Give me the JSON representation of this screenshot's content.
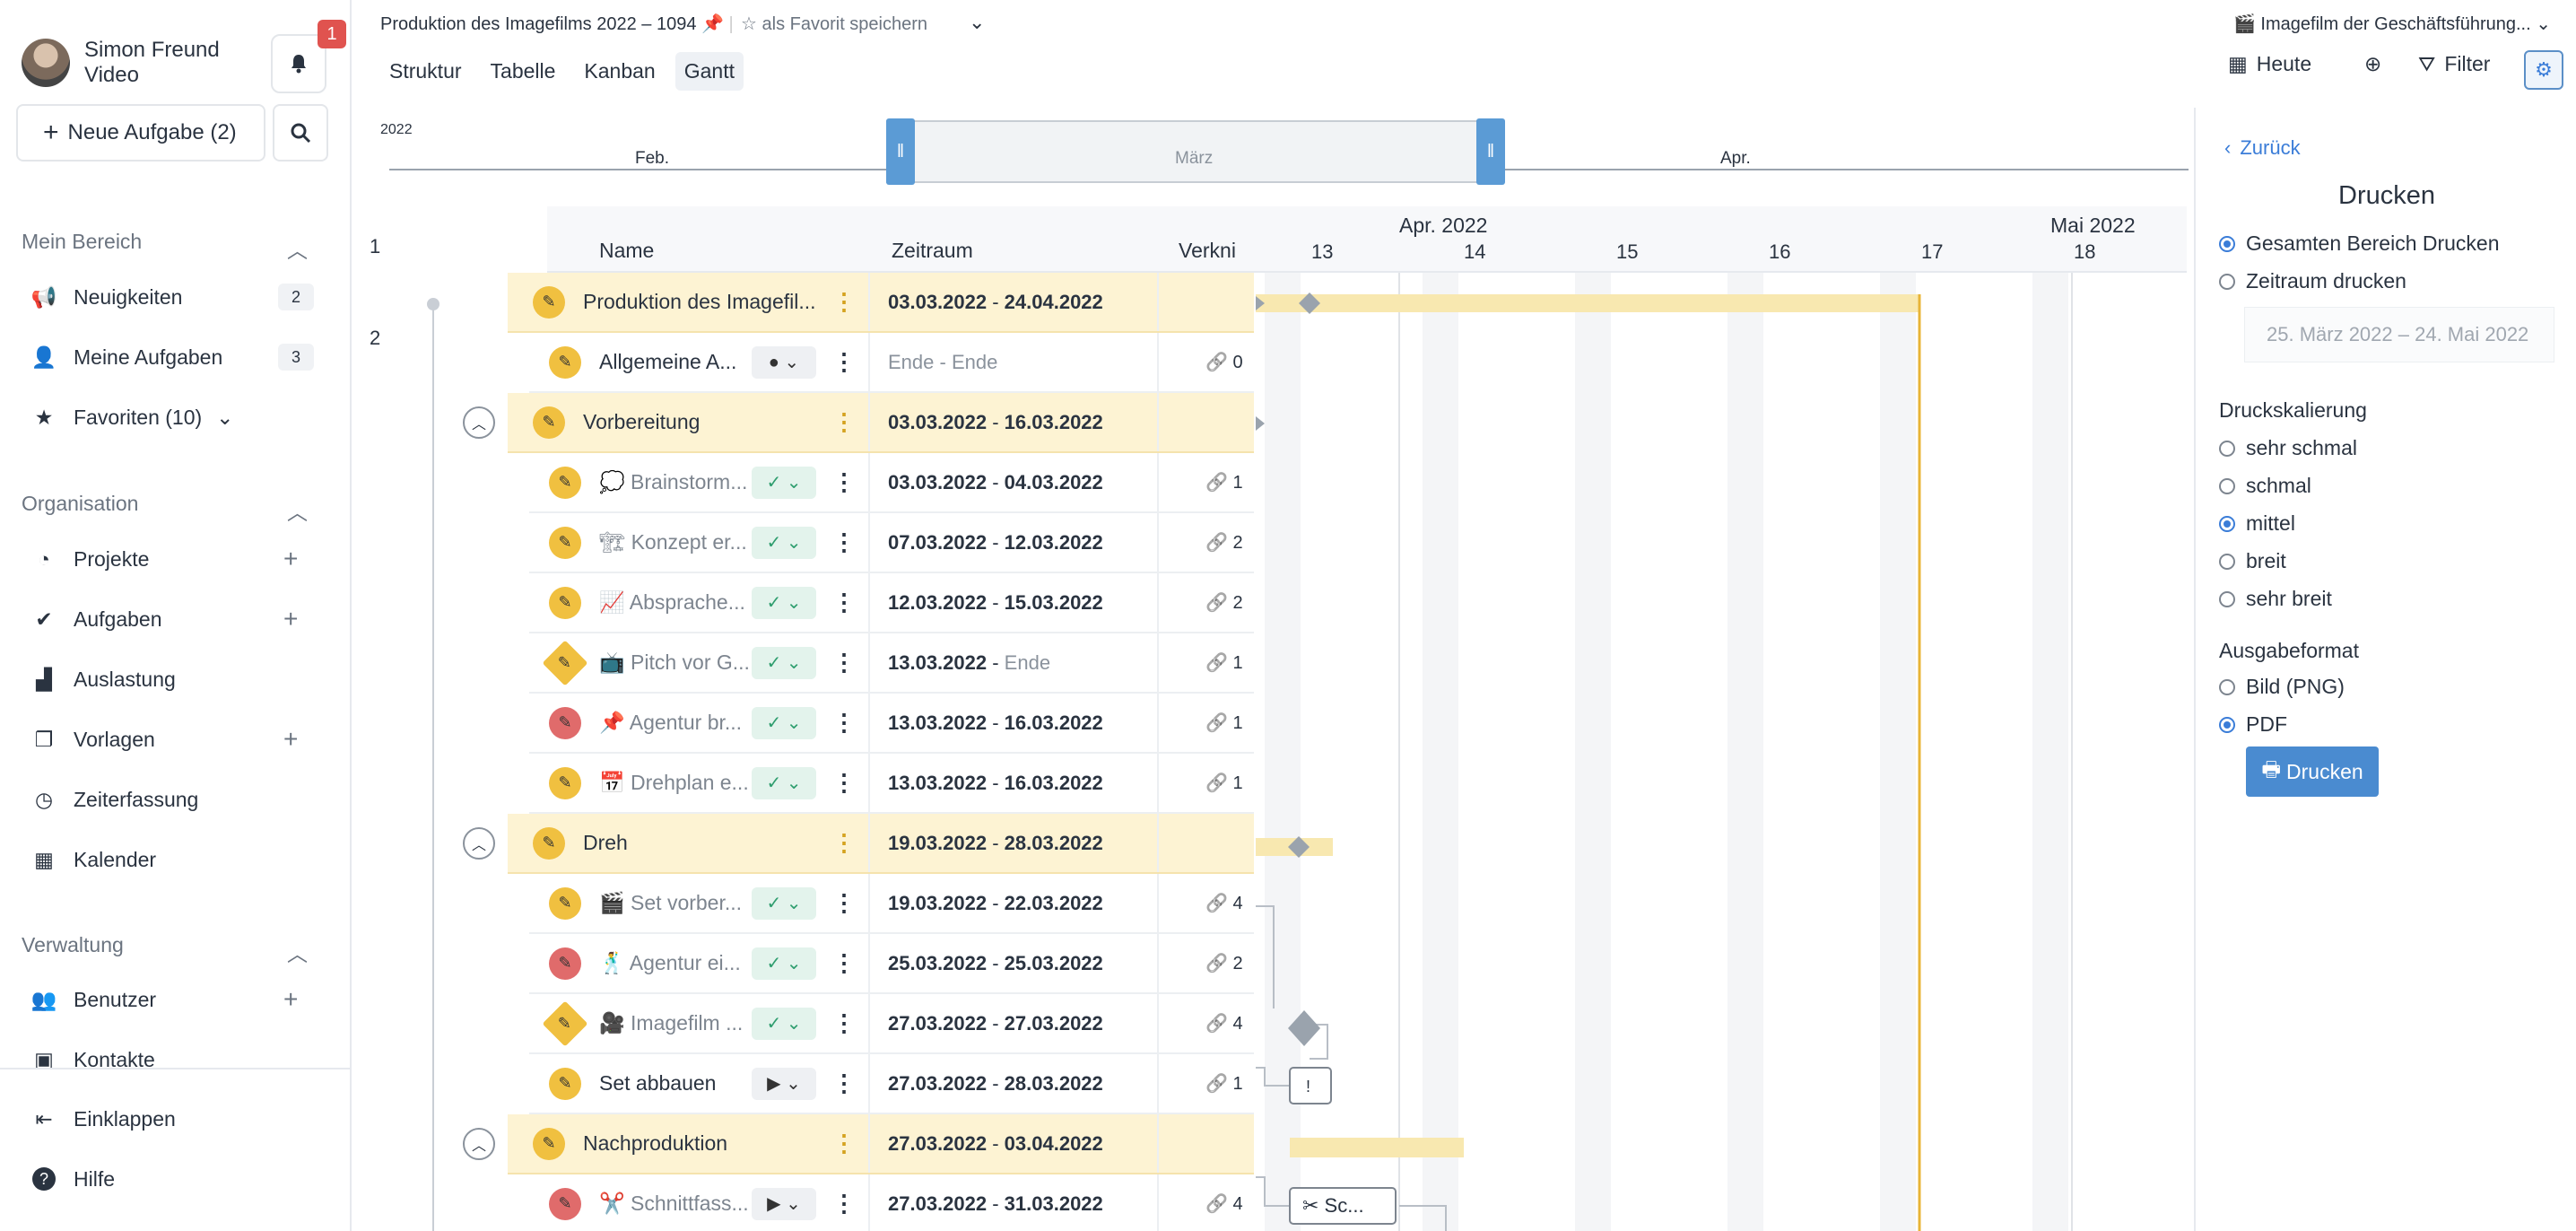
{
  "user": {
    "name": "Simon Freund",
    "role": "Video",
    "notifications": "1"
  },
  "sidebar": {
    "new_task": "Neue Aufgabe (2)",
    "sections": {
      "mein_bereich": "Mein Bereich",
      "organisation": "Organisation",
      "verwaltung": "Verwaltung"
    },
    "items": [
      {
        "label": "Neuigkeiten",
        "count": "2",
        "icon": "megaphone-icon"
      },
      {
        "label": "Meine Aufgaben",
        "count": "3",
        "icon": "user-icon"
      },
      {
        "label": "Favoriten (10)",
        "icon": "star-icon"
      },
      {
        "label": "Projekte",
        "icon": "pie-icon"
      },
      {
        "label": "Aufgaben",
        "icon": "check-icon"
      },
      {
        "label": "Auslastung",
        "icon": "chart-icon"
      },
      {
        "label": "Vorlagen",
        "icon": "template-icon"
      },
      {
        "label": "Zeiterfassung",
        "icon": "clock-icon"
      },
      {
        "label": "Kalender",
        "icon": "calendar-icon"
      },
      {
        "label": "Benutzer",
        "icon": "users-icon"
      },
      {
        "label": "Kontakte",
        "icon": "contacts-icon"
      }
    ],
    "collapse": "Einklappen",
    "help": "Hilfe"
  },
  "header": {
    "breadcrumb": "Produktion des Imagefilms 2022 – 1094",
    "favorite": "als Favorit speichern",
    "tabs": [
      "Struktur",
      "Tabelle",
      "Kanban",
      "Gantt"
    ],
    "active_tab": "Gantt",
    "project": "Imagefilm der Geschäftsführung...",
    "today": "Heute",
    "filter": "Filter"
  },
  "timeline": {
    "year": "2022",
    "months": [
      "Feb.",
      "März",
      "Apr."
    ]
  },
  "grid": {
    "columns": {
      "name": "Name",
      "range": "Zeitraum",
      "links": "Verkni"
    },
    "row_numbers": [
      "1",
      "2"
    ],
    "rows": [
      {
        "type": "group",
        "level": 0,
        "name": "Produktion des Imagefil...",
        "range_start": "03.03.2022",
        "range_end": "24.04.2022"
      },
      {
        "type": "task",
        "level": 1,
        "name": "Allgemeine A...",
        "status": "dot",
        "range_start": "Ende",
        "range_end": "Ende",
        "muted_range": true,
        "links": "0",
        "pen": "yellow"
      },
      {
        "type": "group",
        "level": 1,
        "name": "Vorbereitung",
        "range_start": "03.03.2022",
        "range_end": "16.03.2022"
      },
      {
        "type": "task",
        "level": 2,
        "name": "💭 Brainstorm...",
        "status": "check",
        "range_start": "03.03.2022",
        "range_end": "04.03.2022",
        "links": "1",
        "pen": "yellow"
      },
      {
        "type": "task",
        "level": 2,
        "name": "🏗 Konzept er...",
        "status": "check",
        "range_start": "07.03.2022",
        "range_end": "12.03.2022",
        "links": "2",
        "pen": "yellow"
      },
      {
        "type": "task",
        "level": 2,
        "name": "📈 Absprache...",
        "status": "check",
        "range_start": "12.03.2022",
        "range_end": "15.03.2022",
        "links": "2",
        "pen": "yellow"
      },
      {
        "type": "task",
        "level": 2,
        "name": "📺 Pitch vor G...",
        "status": "check",
        "range_start": "13.03.2022",
        "range_end": "Ende",
        "links": "1",
        "pen": "diamond"
      },
      {
        "type": "task",
        "level": 2,
        "name": "📌 Agentur br...",
        "status": "check",
        "range_start": "13.03.2022",
        "range_end": "16.03.2022",
        "links": "1",
        "pen": "red"
      },
      {
        "type": "task",
        "level": 2,
        "name": "📅 Drehplan e...",
        "status": "check",
        "range_start": "13.03.2022",
        "range_end": "16.03.2022",
        "links": "1",
        "pen": "yellow"
      },
      {
        "type": "group",
        "level": 1,
        "name": "Dreh",
        "range_start": "19.03.2022",
        "range_end": "28.03.2022"
      },
      {
        "type": "task",
        "level": 2,
        "name": "🎬 Set vorber...",
        "status": "check",
        "range_start": "19.03.2022",
        "range_end": "22.03.2022",
        "links": "4",
        "pen": "yellow"
      },
      {
        "type": "task",
        "level": 2,
        "name": "🕺 Agentur ei...",
        "status": "check",
        "range_start": "25.03.2022",
        "range_end": "25.03.2022",
        "links": "2",
        "pen": "red"
      },
      {
        "type": "task",
        "level": 2,
        "name": "🎥 Imagefilm ...",
        "status": "check",
        "range_start": "27.03.2022",
        "range_end": "27.03.2022",
        "links": "4",
        "pen": "diamond"
      },
      {
        "type": "task",
        "level": 2,
        "name": "Set abbauen",
        "status": "play",
        "range_start": "27.03.2022",
        "range_end": "28.03.2022",
        "links": "1",
        "pen": "yellow",
        "plain_name": true
      },
      {
        "type": "group",
        "level": 1,
        "name": "Nachproduktion",
        "range_start": "27.03.2022",
        "range_end": "03.04.2022"
      },
      {
        "type": "task",
        "level": 2,
        "name": "✂️ Schnittfass...",
        "status": "play",
        "range_start": "27.03.2022",
        "range_end": "31.03.2022",
        "links": "4",
        "pen": "red"
      }
    ]
  },
  "chart": {
    "months": [
      "Apr. 2022",
      "Mai 2022"
    ],
    "weeks": [
      "13",
      "14",
      "15",
      "16",
      "17",
      "18"
    ],
    "bar_labels": {
      "set_abbauen": "!",
      "schnitt": "Sc..."
    }
  },
  "panel": {
    "back": "Zurück",
    "title": "Drucken",
    "scope_options": [
      "Gesamten Bereich Drucken",
      "Zeitraum drucken"
    ],
    "scope_selected": 0,
    "date_range": "25. März 2022 – 24. Mai 2022",
    "scale_label": "Druckskalierung",
    "scale_options": [
      "sehr schmal",
      "schmal",
      "mittel",
      "breit",
      "sehr breit"
    ],
    "scale_selected": 2,
    "format_label": "Ausgabeformat",
    "format_options": [
      "Bild (PNG)",
      "PDF"
    ],
    "format_selected": 1,
    "print_button": "Drucken"
  },
  "colors": {
    "accent": "#4a8bd0",
    "group_bg": "#fdf3d3",
    "bar": "#f8e8b0",
    "today_line": "#e8b437"
  }
}
